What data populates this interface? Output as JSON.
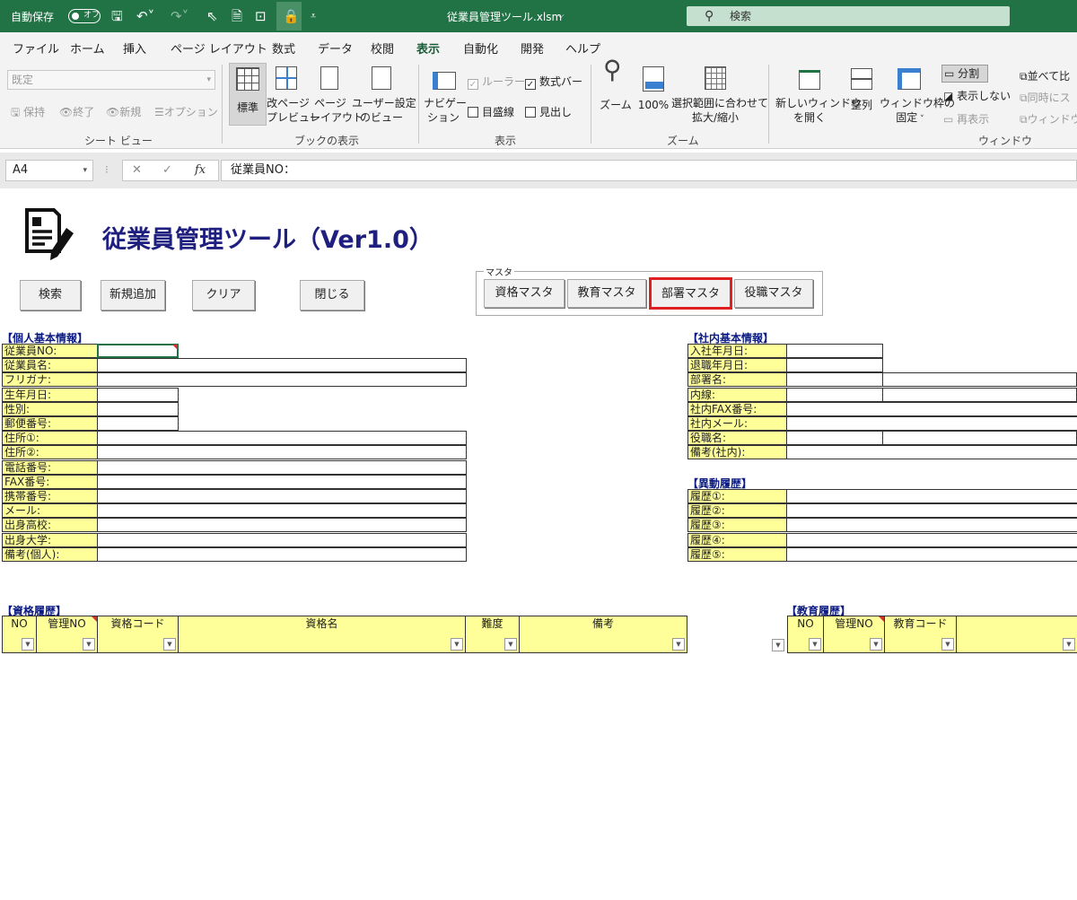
{
  "titlebar": {
    "autosave_label": "自動保存",
    "autosave_state": "オフ",
    "filename": "従業員管理ツール.xlsm",
    "search_placeholder": "検索"
  },
  "menu": [
    "ファイル",
    "ホーム",
    "挿入",
    "ページ レイアウト",
    "数式",
    "データ",
    "校閲",
    "表示",
    "自動化",
    "開発",
    "ヘルプ"
  ],
  "ribbon": {
    "sheetview": {
      "dropdown": "既定",
      "keep": "保持",
      "exit": "終了",
      "new": "新規",
      "options": "オプション",
      "group": "シート ビュー"
    },
    "views": {
      "normal": "標準",
      "pagebreak1": "改ページ",
      "pagebreak2": "プレビュー",
      "pagelayout1": "ページ",
      "pagelayout2": "レイアウト",
      "custom1": "ユーザー設定",
      "custom2": "のビュー",
      "group": "ブックの表示"
    },
    "show": {
      "nav1": "ナビゲー",
      "nav2": "ション",
      "ruler": "ルーラー",
      "formulabar": "数式バー",
      "gridlines": "目盛線",
      "headings": "見出し",
      "group": "表示"
    },
    "zoom": {
      "zoom": "ズーム",
      "zoom100": "100%",
      "fit1": "選択範囲に合わせて",
      "fit2": "拡大/縮小",
      "group": "ズーム"
    },
    "window": {
      "newwin1": "新しいウィンドウ",
      "newwin2": "を開く",
      "arrange": "整列",
      "freeze1": "ウィンドウ枠の",
      "freeze2": "固定",
      "split": "分割",
      "hide": "表示しない",
      "unhide": "再表示",
      "side": "並べて比",
      "sync": "同時にス",
      "reset": "ウィンドウ",
      "group": "ウィンドウ"
    }
  },
  "formula": {
    "cell": "A4",
    "content": "従業員NO："
  },
  "sheet": {
    "title": "従業員管理ツール（Ver1.0）",
    "buttons": {
      "search": "検索",
      "add": "新規追加",
      "clear": "クリア",
      "close": "閉じる"
    },
    "master": {
      "label": "マスタ",
      "qual": "資格マスタ",
      "edu": "教育マスタ",
      "dept": "部署マスタ",
      "role": "役職マスタ"
    },
    "personal": {
      "title": "【個人基本情報】",
      "fields": [
        "従業員NO:",
        "従業員名:",
        "フリガナ:",
        "生年月日:",
        "性別:",
        "郵便番号:",
        "住所①:",
        "住所②:",
        "電話番号:",
        "FAX番号:",
        "携帯番号:",
        "メール:",
        "出身高校:",
        "出身大学:",
        "備考(個人):"
      ]
    },
    "company": {
      "title": "【社内基本情報】",
      "fields": [
        "入社年月日:",
        "退職年月日:",
        "部署名:",
        "内線:",
        "社内FAX番号:",
        "社内メール:",
        "役職名:",
        "備考(社内):"
      ]
    },
    "transfer": {
      "title": "【異動履歴】",
      "fields": [
        "履歴①:",
        "履歴②:",
        "履歴③:",
        "履歴④:",
        "履歴⑤:"
      ]
    },
    "qualhist": {
      "title": "【資格履歴】",
      "cols": [
        "NO",
        "管理NO",
        "資格コード",
        "資格名",
        "難度",
        "備考"
      ]
    },
    "eduhist": {
      "title": "【教育履歴】",
      "cols": [
        "NO",
        "管理NO",
        "教育コード",
        ""
      ]
    }
  }
}
